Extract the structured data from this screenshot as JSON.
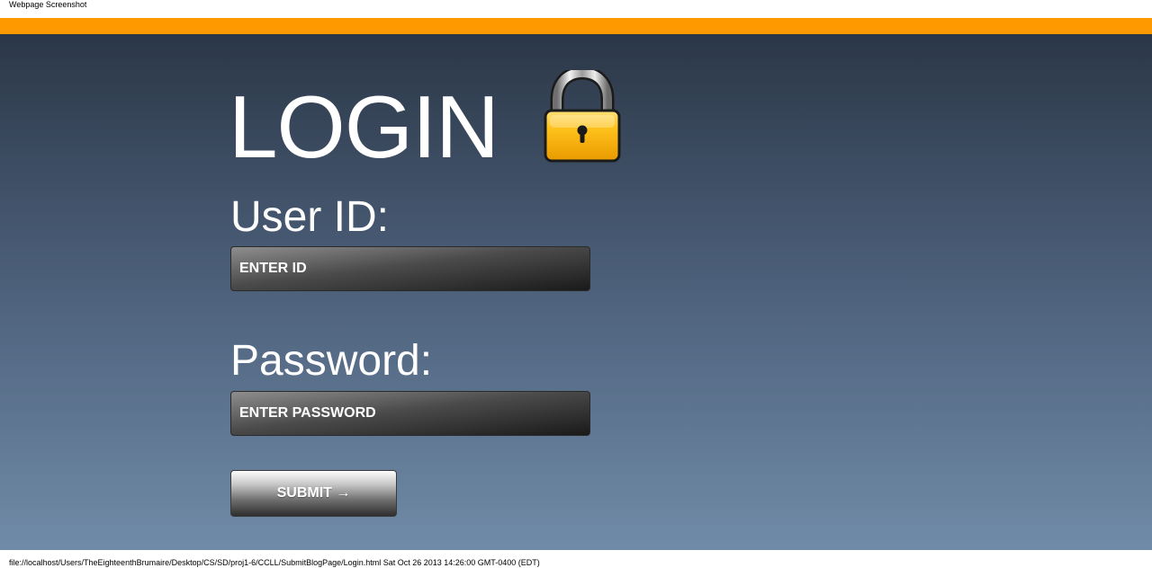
{
  "capture": {
    "header_text": "Webpage Screenshot",
    "footer_text": "file://localhost/Users/TheEighteenthBrumaire/Desktop/CS/SD/proj1-6/CCLL/SubmitBlogPage/Login.html Sat Oct 26 2013 14:26:00 GMT-0400 (EDT)"
  },
  "header": {
    "bar_color": "#ff9900"
  },
  "login": {
    "title": "LOGIN",
    "icon": "lock-icon",
    "user_id_label": "User ID:",
    "user_id_placeholder": "ENTER ID",
    "user_id_value": "",
    "password_label": "Password:",
    "password_placeholder": "ENTER PASSWORD",
    "password_value": "",
    "submit_label": "SUBMIT →"
  },
  "colors": {
    "background_top": "#2b3747",
    "background_bottom": "#708ba8",
    "text": "#ffffff",
    "lock_body": "#f5b800"
  }
}
